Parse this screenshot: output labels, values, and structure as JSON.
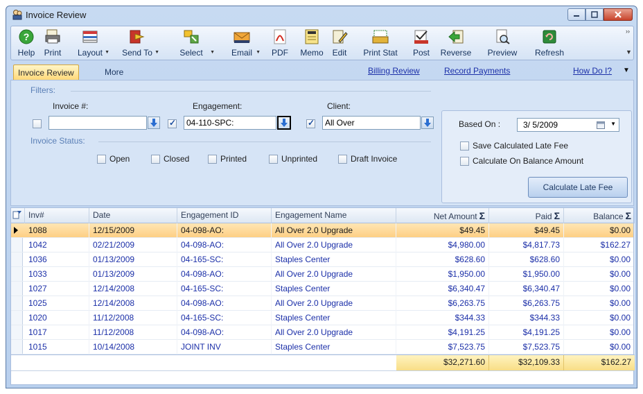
{
  "window": {
    "title": "Invoice Review"
  },
  "toolbar": {
    "buttons": [
      {
        "label": "Help",
        "icon": "help-icon",
        "dropdown": false
      },
      {
        "label": "Print",
        "icon": "print-icon",
        "dropdown": false
      },
      {
        "label": "Layout",
        "icon": "layout-icon",
        "dropdown": true
      },
      {
        "label": "Send To",
        "icon": "send-to-icon",
        "dropdown": true
      },
      {
        "label": "Select",
        "icon": "select-icon",
        "dropdown": true
      },
      {
        "label": "Email",
        "icon": "email-icon",
        "dropdown": true
      },
      {
        "label": "PDF",
        "icon": "pdf-icon",
        "dropdown": false
      },
      {
        "label": "Memo",
        "icon": "memo-icon",
        "dropdown": false
      },
      {
        "label": "Edit",
        "icon": "edit-icon",
        "dropdown": false
      },
      {
        "label": "Print Stat",
        "icon": "print-stat-icon",
        "dropdown": false
      },
      {
        "label": "Post",
        "icon": "post-icon",
        "dropdown": false
      },
      {
        "label": "Reverse",
        "icon": "reverse-icon",
        "dropdown": false
      },
      {
        "label": "Preview",
        "icon": "preview-icon",
        "dropdown": false
      },
      {
        "label": "Refresh",
        "icon": "refresh-icon",
        "dropdown": false
      }
    ]
  },
  "tabs": {
    "active": "Invoice Review",
    "other": "More"
  },
  "links": {
    "billing_review": "Billing Review",
    "record_payments": "Record Payments",
    "how_do_i": "How Do I?"
  },
  "filters": {
    "caption": "Filters:",
    "invoice_label": "Invoice #:",
    "invoice_value": "",
    "invoice_checked": false,
    "engagement_label": "Engagement:",
    "engagement_value": "04-110-SPC:",
    "engagement_checked": true,
    "client_label": "Client:",
    "client_value": "All Over",
    "client_checked": true
  },
  "invoice_status": {
    "caption": "Invoice Status:",
    "options": [
      {
        "label": "Open",
        "checked": false
      },
      {
        "label": "Closed",
        "checked": false
      },
      {
        "label": "Printed",
        "checked": false
      },
      {
        "label": "Unprinted",
        "checked": false
      },
      {
        "label": "Draft Invoice",
        "checked": false
      }
    ]
  },
  "late_fee": {
    "based_on_label": "Based On :",
    "based_on_date": "3/ 5/2009",
    "save_label": "Save Calculated Late Fee",
    "save_checked": false,
    "balance_label": "Calculate On Balance Amount",
    "balance_checked": false,
    "button_label": "Calculate Late Fee"
  },
  "grid": {
    "columns": [
      "Inv#",
      "Date",
      "Engagement ID",
      "Engagement Name",
      "Net Amount",
      "Paid",
      "Balance"
    ],
    "rows": [
      [
        "1088",
        "12/15/2009",
        "04-098-AO:",
        "All Over 2.0 Upgrade",
        "$49.45",
        "$49.45",
        "$0.00"
      ],
      [
        "1042",
        "02/21/2009",
        "04-098-AO:",
        "All Over 2.0 Upgrade",
        "$4,980.00",
        "$4,817.73",
        "$162.27"
      ],
      [
        "1036",
        "01/13/2009",
        "04-165-SC:",
        "Staples Center",
        "$628.60",
        "$628.60",
        "$0.00"
      ],
      [
        "1033",
        "01/13/2009",
        "04-098-AO:",
        "All Over 2.0 Upgrade",
        "$1,950.00",
        "$1,950.00",
        "$0.00"
      ],
      [
        "1027",
        "12/14/2008",
        "04-165-SC:",
        "Staples Center",
        "$6,340.47",
        "$6,340.47",
        "$0.00"
      ],
      [
        "1025",
        "12/14/2008",
        "04-098-AO:",
        "All Over 2.0 Upgrade",
        "$6,263.75",
        "$6,263.75",
        "$0.00"
      ],
      [
        "1020",
        "11/12/2008",
        "04-165-SC:",
        "Staples Center",
        "$344.33",
        "$344.33",
        "$0.00"
      ],
      [
        "1017",
        "11/12/2008",
        "04-098-AO:",
        "All Over 2.0 Upgrade",
        "$4,191.25",
        "$4,191.25",
        "$0.00"
      ],
      [
        "1015",
        "10/14/2008",
        "JOINT INV",
        "Staples Center",
        "$7,523.75",
        "$7,523.75",
        "$0.00"
      ]
    ],
    "totals": {
      "net": "$32,271.60",
      "paid": "$32,109.33",
      "balance": "$162.27"
    },
    "sigma": "Σ"
  }
}
